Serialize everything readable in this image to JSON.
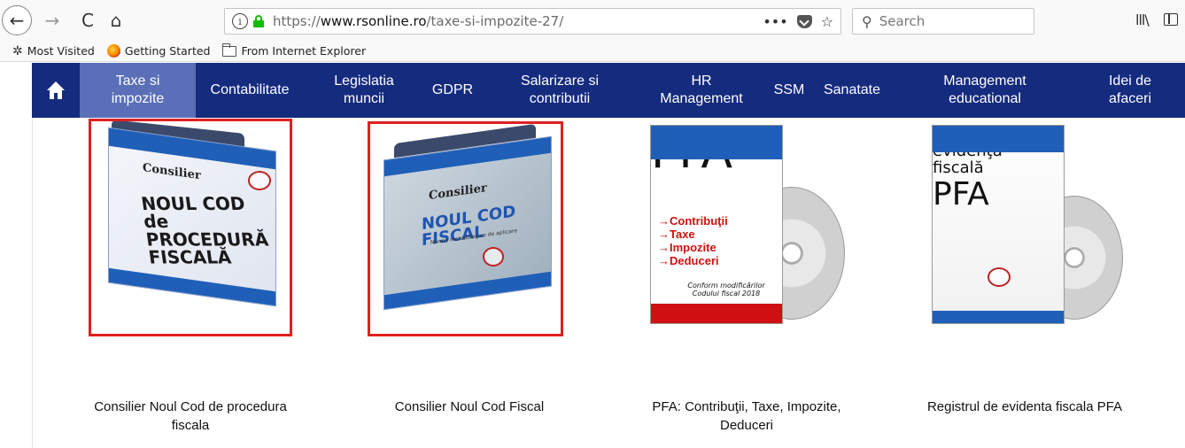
{
  "browser": {
    "url_scheme": "https://",
    "url_host": "www.rsonline.ro",
    "url_path": "/taxe-si-impozite-27/",
    "url_more": "•••",
    "url_star": "☆",
    "search_placeholder": "Search",
    "back_glyph": "←",
    "forward_glyph": "→",
    "reload_glyph": "C",
    "home_glyph": "⌂",
    "info_glyph": "i",
    "search_glyph": "⚲",
    "library_glyph": "lll\\"
  },
  "bookmarks": [
    {
      "label": "Most Visited",
      "icon": "gear-icon"
    },
    {
      "label": "Getting Started",
      "icon": "firefox-icon"
    },
    {
      "label": "From Internet Explorer",
      "icon": "folder-icon"
    }
  ],
  "site_nav": {
    "home_icon": "home-icon",
    "items": [
      {
        "label": "Taxe si impozite",
        "active": true
      },
      {
        "label": "Contabilitate",
        "active": false
      },
      {
        "label": "Legislatia muncii",
        "active": false
      },
      {
        "label": "GDPR",
        "active": false
      },
      {
        "label": "Salarizare si contributii",
        "active": false
      },
      {
        "label": "HR Management",
        "active": false
      },
      {
        "label": "SSM",
        "active": false
      },
      {
        "label": "Sanatate",
        "active": false
      },
      {
        "label": "Management educational",
        "active": false
      },
      {
        "label": "Idei de afaceri",
        "active": false
      }
    ],
    "colors": {
      "background": "#152b7e",
      "active": "#5a6fb8"
    }
  },
  "products": [
    {
      "title": "Consilier Noul Cod de procedura fiscala",
      "cover_brand": "Consilier",
      "cover_text": "NOUL COD de PROCEDURĂ FISCALĂ",
      "highlighted": true
    },
    {
      "title": "Consilier Noul Cod Fiscal",
      "cover_brand": "Consilier",
      "cover_text": "NOUL COD FISCAL",
      "cover_subtext": "Norme metodologice de aplicare",
      "highlighted": true
    },
    {
      "title": "PFA: Contribuţii, Taxe, Impozite, Deduceri",
      "cover_big": "PFA",
      "cover_list": [
        "→Contribuţii",
        "→Taxe",
        "→Impozite",
        "→Deduceri"
      ],
      "cover_note": "Conform modificărilor Codului fiscal 2018",
      "highlighted": false
    },
    {
      "title": "Registrul de evidenta fiscala PFA",
      "cover_heading": "Registrul de evidenţă fiscală",
      "cover_big": "PFA",
      "highlighted": false
    }
  ],
  "highlight_color": "#e02020"
}
